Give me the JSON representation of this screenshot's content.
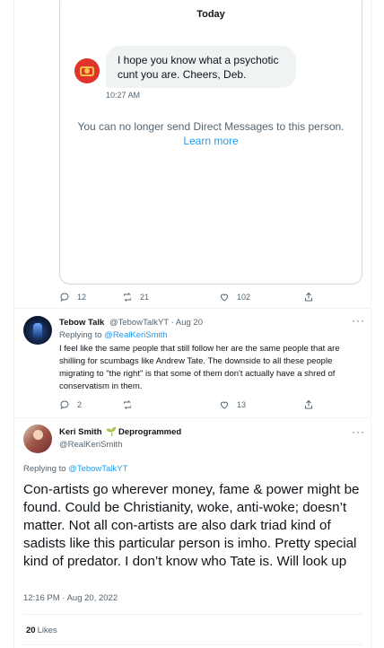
{
  "dm": {
    "day": "Today",
    "message": "I hope you know what a psychotic cunt you are. Cheers, Deb.",
    "time": "10:27 AM",
    "notice": "You can no longer send Direct Messages to this person.",
    "learn_more": "Learn more"
  },
  "first_tweet_actions": {
    "replies": "12",
    "retweets": "21",
    "likes": "102"
  },
  "reply_tweet": {
    "name": "Tebow Talk",
    "handle": "@TebowTalkYT",
    "separator": "·",
    "date": "Aug 20",
    "replying_prefix": "Replying to ",
    "replying_to": "@RealKeriSmith",
    "text": "I feel like the same people that still follow her are the same people that are shilling for scumbags like Andrew Tate. The downside to all these people migrating to \"the right\" is that some of them don't actually have a shred of conservatism in them.",
    "replies": "2",
    "retweets": "",
    "likes": "13",
    "more": "···"
  },
  "main_tweet": {
    "name": "Keri Smith",
    "emoji": "🌱",
    "name_suffix": "Deprogrammed",
    "handle": "@RealKeriSmith",
    "replying_prefix": "Replying to ",
    "replying_to": "@TebowTalkYT",
    "text": "Con-artists go wherever money, fame & power might be found. Could be Christianity, woke, anti-woke; doesn’t matter. Not all con-artists are also dark triad kind of sadists like this particular person is imho. Pretty special kind of predator. I don’t know who Tate is. Will look up",
    "timestamp": "12:16 PM · Aug 20, 2022",
    "likes_count": "20",
    "likes_label": "Likes",
    "more": "···"
  },
  "colors": {
    "accent": "#1d9bf0",
    "muted": "#536471",
    "text": "#0f1419",
    "border": "#cfd9de"
  },
  "icons": [
    "reply-icon",
    "retweet-icon",
    "like-icon",
    "share-icon",
    "more-icon"
  ]
}
